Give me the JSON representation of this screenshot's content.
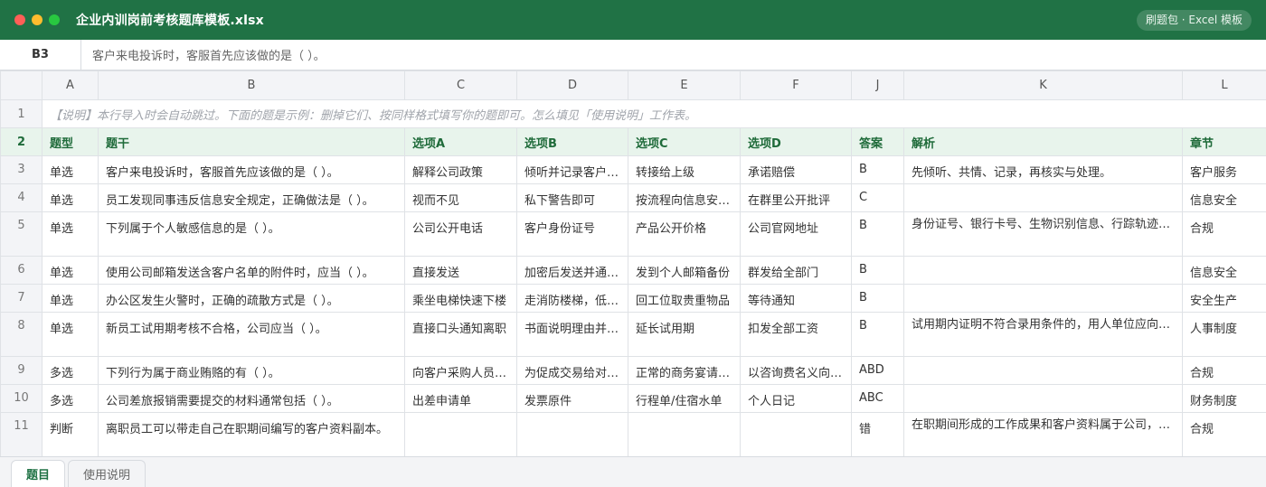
{
  "window": {
    "title": "企业内训岗前考核题库模板.xlsx",
    "badge": "刷题包 · Excel 模板",
    "colors": {
      "close": "#ff5f57",
      "minimize": "#febc2e",
      "maximize": "#28c840",
      "accent": "#207245"
    }
  },
  "formula_bar": {
    "cell_ref": "B3",
    "content": "客户来电投诉时，客服首先应该做的是（ ）。"
  },
  "columns": [
    "A",
    "B",
    "C",
    "D",
    "E",
    "F",
    "J",
    "K",
    "L"
  ],
  "note_row": {
    "num": "1",
    "text": "【说明】本行导入时会自动跳过。下面的题是示例：删掉它们、按同样格式填写你的题即可。怎么填见「使用说明」工作表。"
  },
  "header_row": {
    "num": "2",
    "cells": [
      "题型",
      "题干",
      "选项A",
      "选项B",
      "选项C",
      "选项D",
      "答案",
      "解析",
      "章节"
    ]
  },
  "rows": [
    {
      "num": "3",
      "cells": [
        "单选",
        "客户来电投诉时，客服首先应该做的是（ ）。",
        "解释公司政策",
        "倾听并记录客户诉求",
        "转接给上级",
        "承诺赔偿",
        "B",
        "先倾听、共情、记录，再核实与处理。",
        "客户服务"
      ]
    },
    {
      "num": "4",
      "cells": [
        "单选",
        "员工发现同事违反信息安全规定，正确做法是（ ）。",
        "视而不见",
        "私下警告即可",
        "按流程向信息安全部门报告",
        "在群里公开批评",
        "C",
        "",
        "信息安全"
      ]
    },
    {
      "num": "5",
      "cells": [
        "单选",
        "下列属于个人敏感信息的是（ ）。",
        "公司公开电话",
        "客户身份证号",
        "产品公开价格",
        "公司官网地址",
        "B",
        "身份证号、银行卡号、生物识别信息、行踪轨迹等属于敏感个人信息。",
        "合规"
      ]
    },
    {
      "num": "6",
      "cells": [
        "单选",
        "使用公司邮箱发送含客户名单的附件时，应当（ ）。",
        "直接发送",
        "加密后发送并通过其他渠道告知密码",
        "发到个人邮箱备份",
        "群发给全部门",
        "B",
        "",
        "信息安全"
      ]
    },
    {
      "num": "7",
      "cells": [
        "单选",
        "办公区发生火警时，正确的疏散方式是（ ）。",
        "乘坐电梯快速下楼",
        "走消防楼梯，低姿捂鼻撤离",
        "回工位取贵重物品",
        "等待通知",
        "B",
        "",
        "安全生产"
      ]
    },
    {
      "num": "8",
      "cells": [
        "单选",
        "新员工试用期考核不合格，公司应当（ ）。",
        "直接口头通知离职",
        "书面说明理由并依法解除",
        "延长试用期",
        "扣发全部工资",
        "B",
        "试用期内证明不符合录用条件的，用人单位应向劳动者说明理由。",
        "人事制度"
      ]
    },
    {
      "num": "9",
      "cells": [
        "多选",
        "下列行为属于商业贿赂的有（ ）。",
        "向客户采购人员送购物卡",
        "为促成交易给对方回扣",
        "正常的商务宴请招待",
        "以咨询费名义向对方付款",
        "ABD",
        "",
        "合规"
      ]
    },
    {
      "num": "10",
      "cells": [
        "多选",
        "公司差旅报销需要提交的材料通常包括（ ）。",
        "出差申请单",
        "发票原件",
        "行程单/住宿水单",
        "个人日记",
        "ABC",
        "",
        "财务制度"
      ]
    },
    {
      "num": "11",
      "cells": [
        "判断",
        "离职员工可以带走自己在职期间编写的客户资料副本。",
        "",
        "",
        "",
        "",
        "错",
        "在职期间形成的工作成果和客户资料属于公司，离职时应归还并删除。",
        "合规"
      ]
    }
  ],
  "sheet_tabs": [
    {
      "label": "题目",
      "active": true
    },
    {
      "label": "使用说明",
      "active": false
    }
  ]
}
